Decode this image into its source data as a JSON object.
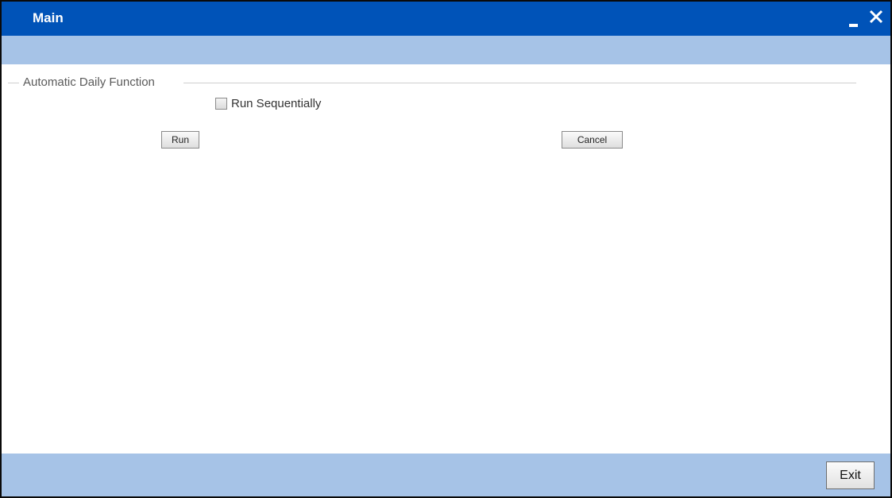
{
  "window": {
    "title": "Main",
    "minimize_icon": "minimize-icon",
    "close_icon": "close-icon"
  },
  "section": {
    "legend": "Automatic Daily Function",
    "run_sequentially_label": "Run Sequentially",
    "run_sequentially_checked": false
  },
  "actions": {
    "run_label": "Run",
    "cancel_label": "Cancel"
  },
  "footer": {
    "exit_label": "Exit"
  },
  "colors": {
    "titlebar": "#0053b8",
    "toolbar": "#a6c3e7",
    "footer": "#a6c3e7"
  }
}
